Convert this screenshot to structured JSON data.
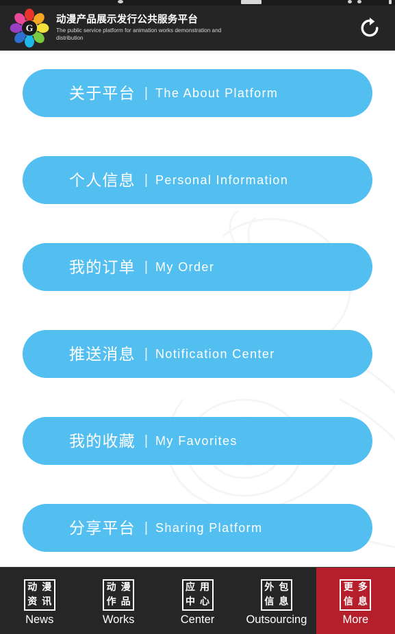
{
  "statusbar": {
    "present": true
  },
  "header": {
    "logo_icon": "colorful-star-logo-g",
    "title_cn": "动漫产品展示发行公共服务平台",
    "title_en": "The public service platform for animation works demonstration and distribution",
    "refresh_icon": "refresh-icon"
  },
  "colors": {
    "header_bg": "#252525",
    "button_blue": "#53BFF0",
    "tabbar_bg": "#262626",
    "active_tab_red": "#B51E2B",
    "text_white": "#FFFFFF"
  },
  "menu": {
    "items": [
      {
        "cn": "关于平台",
        "sep": "|",
        "en": "The  About  Platform",
        "name": "about-platform"
      },
      {
        "cn": "个人信息",
        "sep": "|",
        "en": "Personal  Information",
        "name": "personal-information"
      },
      {
        "cn": "我的订单",
        "sep": "|",
        "en": "My  Order",
        "name": "my-order"
      },
      {
        "cn": "推送消息",
        "sep": "|",
        "en": "Notification  Center",
        "name": "notification-center"
      },
      {
        "cn": "我的收藏",
        "sep": "|",
        "en": "My  Favorites",
        "name": "my-favorites"
      },
      {
        "cn": "分享平台",
        "sep": "|",
        "en": "Sharing  Platform",
        "name": "sharing-platform"
      }
    ]
  },
  "tabbar": {
    "items": [
      {
        "label": "News",
        "icon_chars": [
          "动",
          "漫",
          "资",
          "讯"
        ],
        "active": false,
        "name": "news"
      },
      {
        "label": "Works",
        "icon_chars": [
          "动",
          "漫",
          "作",
          "品"
        ],
        "active": false,
        "name": "works"
      },
      {
        "label": "Center",
        "icon_chars": [
          "应",
          "用",
          "中",
          "心"
        ],
        "active": false,
        "name": "center"
      },
      {
        "label": "Outsourcing",
        "icon_chars": [
          "外",
          "包",
          "信",
          "息"
        ],
        "active": false,
        "name": "outsourcing"
      },
      {
        "label": "More",
        "icon_chars": [
          "更",
          "多",
          "信",
          "息"
        ],
        "active": true,
        "name": "more"
      }
    ]
  }
}
